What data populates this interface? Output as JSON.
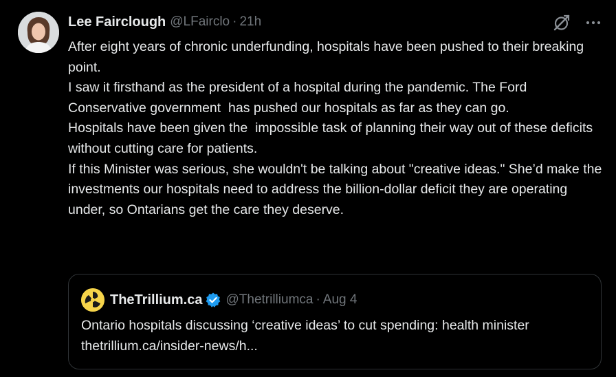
{
  "tweet": {
    "author_name": "Lee Fairclough",
    "author_handle": "@LFairclo",
    "separator": "·",
    "time": "21h",
    "lines": [
      "After eight years of chronic underfunding, hospitals have been pushed to their breaking point.",
      "I saw it firsthand as the president of a hospital during the pandemic. The Ford Conservative government  has pushed our hospitals as far as they can go.",
      "Hospitals have been given the  impossible task of planning their way out of these deficits without cutting care for patients.",
      "If this Minister was serious, she wouldn't be talking about \"creative ideas.\" She’d make the investments our hospitals need to address the billion-dollar deficit they are operating under, so Ontarians get the care they deserve."
    ],
    "icons": {
      "grok": "grok-icon",
      "more": "more-icon"
    }
  },
  "quote": {
    "author_name": "TheTrillium.ca",
    "author_handle": "@Thetrilliumca",
    "separator": "·",
    "date": "Aug 4",
    "text": "Ontario hospitals discussing ‘creative ideas’ to cut spending: health minister thetrillium.ca/insider-news/h...",
    "verified_icon": "verified-badge-icon",
    "verified_color": "#1d9bf0"
  },
  "colors": {
    "background": "#000000",
    "text": "#e7e9ea",
    "muted": "#71767b",
    "border": "#2f3336"
  }
}
